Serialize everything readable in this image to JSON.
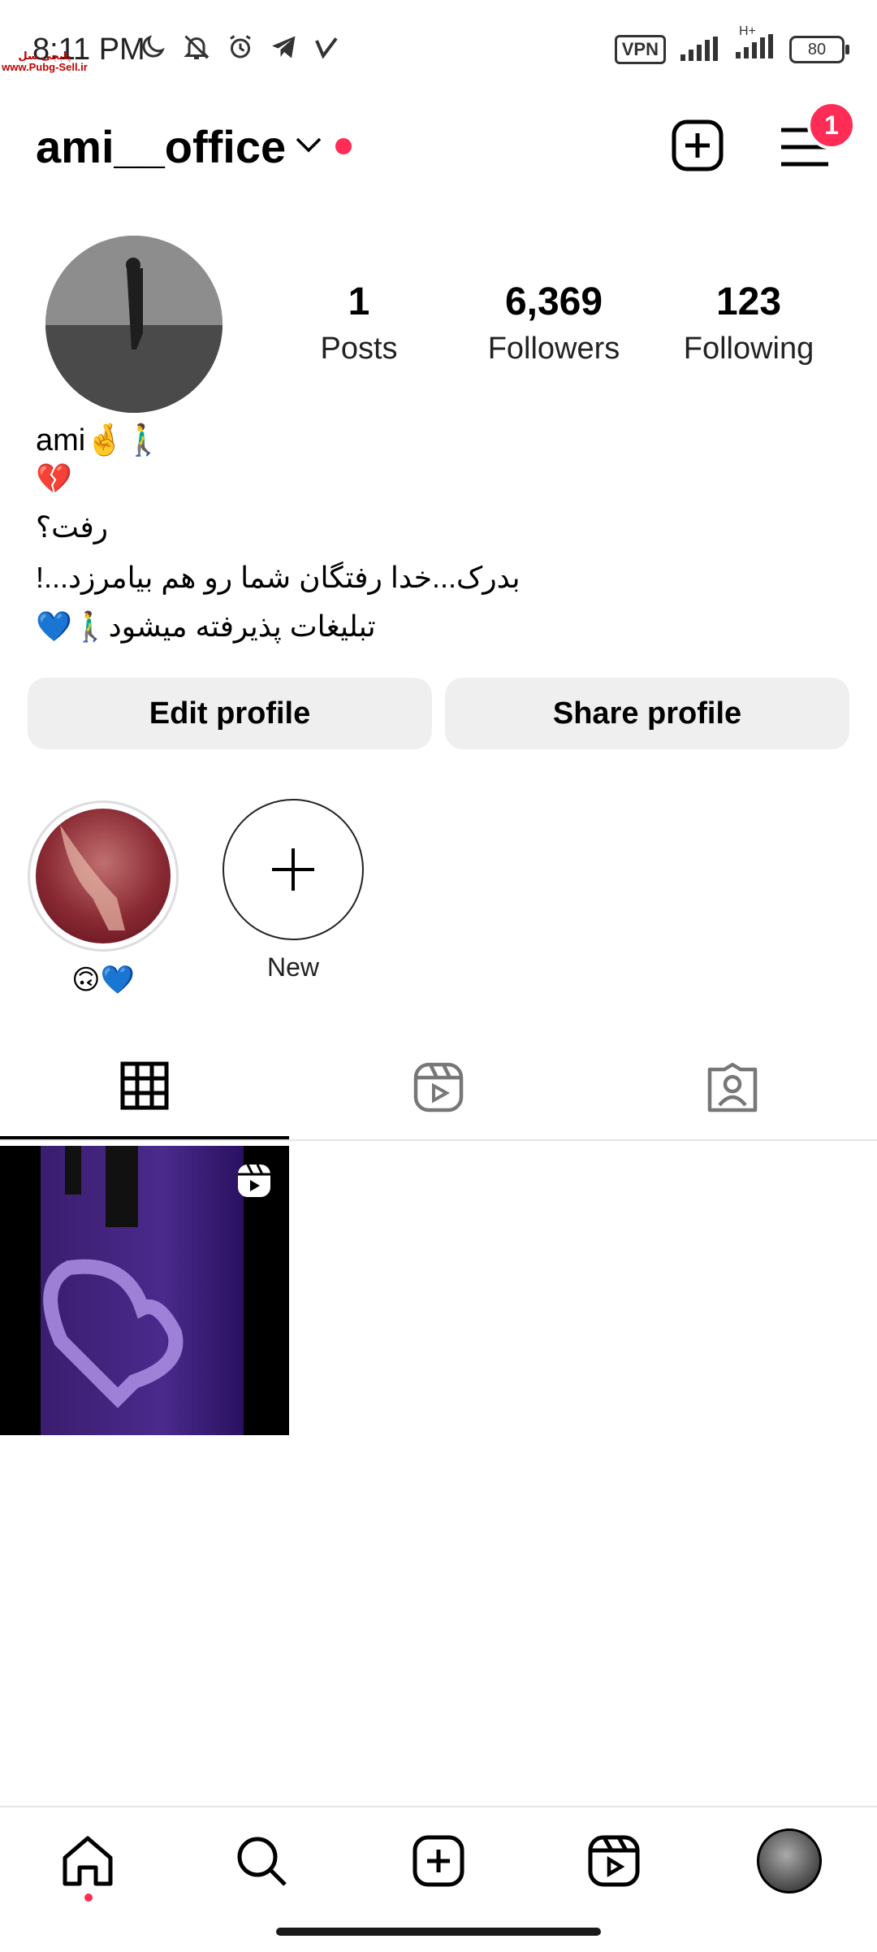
{
  "status_bar": {
    "time": "8:11 PM",
    "vpn": "VPN",
    "network": "H+",
    "battery": "80",
    "watermark_line1": "پابجی سل",
    "watermark_line2": "www.Pubg-Sell.ir"
  },
  "header": {
    "username": "ami__office",
    "notification_count": "1"
  },
  "profile": {
    "stats": [
      {
        "value": "1",
        "label": "Posts"
      },
      {
        "value": "6,369",
        "label": "Followers"
      },
      {
        "value": "123",
        "label": "Following"
      }
    ],
    "name": "ami🤞🚶‍♂️",
    "bio_lines": [
      "💔",
      "رفت؟",
      "بدرک...خدا رفتگان شما رو هم بیامرزد...!",
      "تبلیغات پذیرفته میشود🚶‍♂️💙"
    ]
  },
  "actions": {
    "edit_profile": "Edit profile",
    "share_profile": "Share profile"
  },
  "highlights": {
    "items": [
      {
        "label": "🙃💙"
      }
    ],
    "new_label": "New"
  },
  "tabs": [
    "posts-grid",
    "reels",
    "tagged"
  ],
  "posts": [
    {
      "type": "reel"
    }
  ],
  "colors": {
    "accent_red": "#ff2d55",
    "button_bg": "#efefef"
  }
}
